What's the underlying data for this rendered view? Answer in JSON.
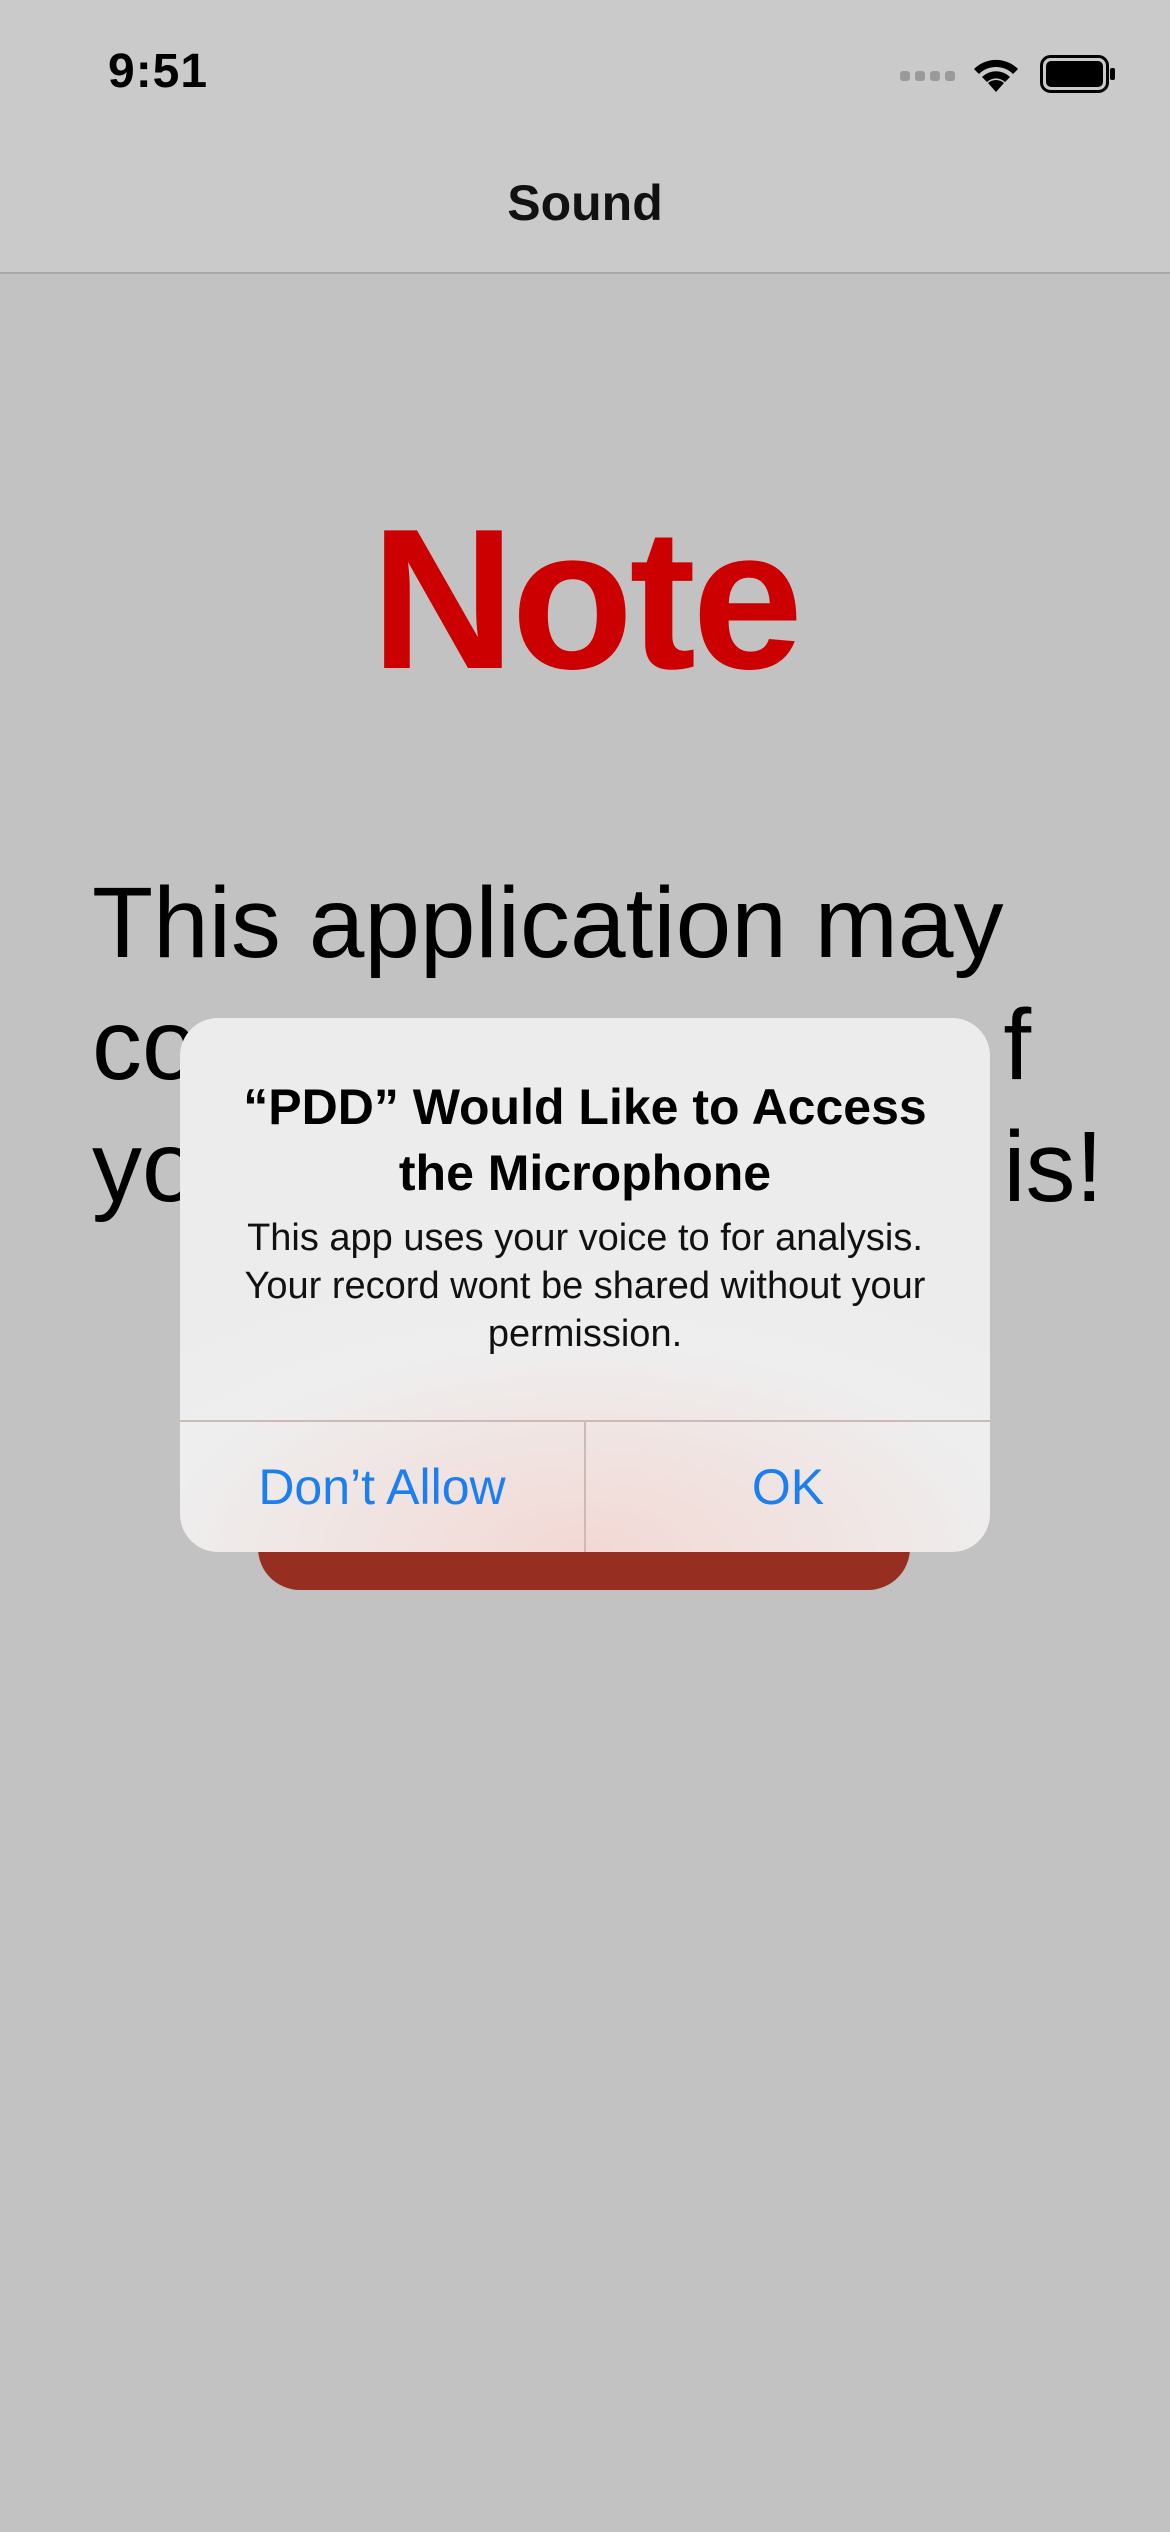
{
  "status_bar": {
    "time": "9:51",
    "icons": [
      "signal-icon",
      "wifi-icon",
      "battery-icon"
    ]
  },
  "nav": {
    "title": "Sound"
  },
  "main": {
    "heading": "Note",
    "heading_color": "#cc0000",
    "body_visible": "This application may\nco                             f\nyo                             is!",
    "button_color": "#962f22"
  },
  "alert": {
    "title": "“PDD” Would Like to Access the Microphone",
    "message": "This app uses your voice to for analysis. Your record wont be shared without your permission.",
    "buttons": [
      {
        "label": "Don’t Allow"
      },
      {
        "label": "OK"
      }
    ],
    "button_color": "#1a7ff0"
  }
}
